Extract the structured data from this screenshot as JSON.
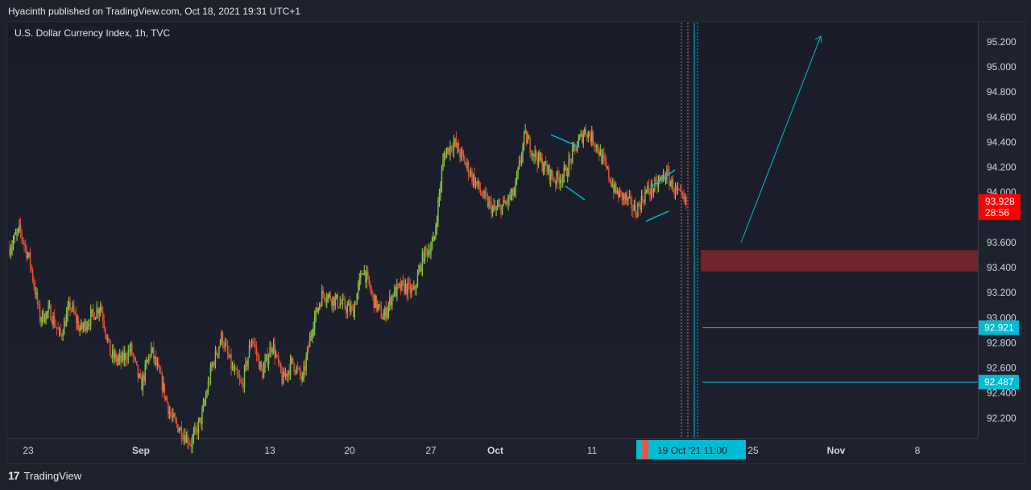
{
  "header": {
    "published": "Hyacinth published on TradingView.com, Oct 18, 2021 19:31 UTC+1"
  },
  "chart_data": {
    "type": "candlestick",
    "symbol": "U.S. Dollar Currency Index, 1h, TVC",
    "y_range": [
      92.0,
      95.4
    ],
    "y_ticks": [
      "95.200",
      "95.000",
      "94.800",
      "94.600",
      "94.400",
      "94.200",
      "94.000",
      "93.600",
      "93.400",
      "93.200",
      "93.000",
      "92.800",
      "92.600",
      "92.400",
      "92.200"
    ],
    "x_ticks": [
      "23",
      "Sep",
      "13",
      "20",
      "27",
      "Oct",
      "11",
      "25",
      "Nov",
      "8"
    ],
    "last_price": {
      "value": "93.928",
      "countdown": "28:56"
    },
    "price_labels": [
      "92.921",
      "92.487"
    ],
    "crosshair_date": "19 Oct '21   11:00",
    "price_path": [
      [
        0,
        93.56
      ],
      [
        1,
        93.7
      ],
      [
        2,
        93.45
      ],
      [
        3,
        93.0
      ],
      [
        4,
        93.05
      ],
      [
        5,
        92.85
      ],
      [
        6,
        93.1
      ],
      [
        7,
        92.9
      ],
      [
        8,
        93.0
      ],
      [
        9,
        93.1
      ],
      [
        10,
        92.7
      ],
      [
        11,
        92.65
      ],
      [
        12,
        92.75
      ],
      [
        13,
        92.45
      ],
      [
        14,
        92.75
      ],
      [
        15,
        92.5
      ],
      [
        16,
        92.2
      ],
      [
        17,
        92.1
      ],
      [
        18,
        92.0
      ],
      [
        19,
        92.2
      ],
      [
        20,
        92.6
      ],
      [
        21,
        92.85
      ],
      [
        22,
        92.6
      ],
      [
        23,
        92.45
      ],
      [
        24,
        92.85
      ],
      [
        25,
        92.55
      ],
      [
        26,
        92.8
      ],
      [
        27,
        92.5
      ],
      [
        28,
        92.65
      ],
      [
        29,
        92.5
      ],
      [
        30,
        92.95
      ],
      [
        31,
        93.2
      ],
      [
        32,
        93.15
      ],
      [
        33,
        93.1
      ],
      [
        34,
        93.05
      ],
      [
        35,
        93.4
      ],
      [
        36,
        93.15
      ],
      [
        37,
        93.0
      ],
      [
        38,
        93.2
      ],
      [
        39,
        93.25
      ],
      [
        40,
        93.2
      ],
      [
        41,
        93.5
      ],
      [
        42,
        93.6
      ],
      [
        43,
        94.3
      ],
      [
        44,
        94.4
      ],
      [
        45,
        94.25
      ],
      [
        46,
        94.1
      ],
      [
        47,
        93.95
      ],
      [
        48,
        93.85
      ],
      [
        49,
        93.9
      ],
      [
        50,
        94.0
      ],
      [
        51,
        94.45
      ],
      [
        52,
        94.3
      ],
      [
        53,
        94.2
      ],
      [
        54,
        94.1
      ],
      [
        55,
        94.15
      ],
      [
        56,
        94.35
      ],
      [
        57,
        94.5
      ],
      [
        58,
        94.4
      ],
      [
        59,
        94.2
      ],
      [
        60,
        94.0
      ],
      [
        61,
        93.95
      ],
      [
        62,
        93.85
      ],
      [
        63,
        94.0
      ],
      [
        64,
        94.05
      ],
      [
        65,
        94.15
      ],
      [
        66,
        94.0
      ],
      [
        67,
        93.9
      ]
    ],
    "colors": {
      "up": "#26a69a",
      "down": "#ef5350",
      "accent": "#00bcd4",
      "zone": "#7b2529",
      "last": "#ff0000"
    }
  },
  "footer": {
    "brand": "TradingView"
  }
}
